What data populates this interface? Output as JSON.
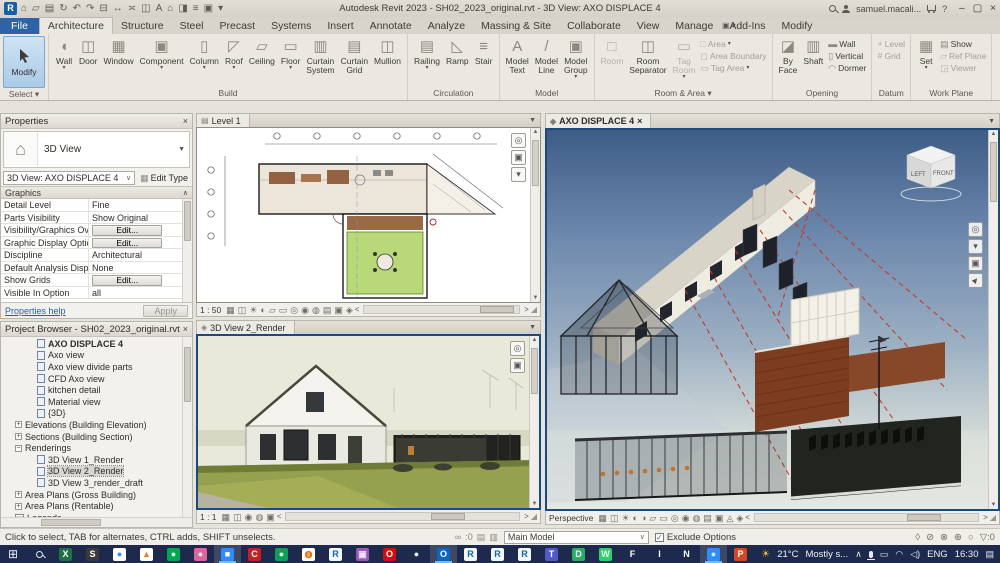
{
  "title_bar": {
    "app_title": "Autodesk Revit 2023 - SH02_2023_original.rvt - 3D View: AXO DISPLACE 4",
    "logo_letter": "R",
    "qat": [
      {
        "name": "home-icon",
        "glyph": "⌂"
      },
      {
        "name": "open-icon",
        "glyph": "▱"
      },
      {
        "name": "save-icon",
        "glyph": "▤"
      },
      {
        "name": "sync-with-central-icon",
        "glyph": "↻"
      },
      {
        "name": "undo-icon",
        "glyph": "↶"
      },
      {
        "name": "redo-icon",
        "glyph": "↷"
      },
      {
        "name": "print-icon",
        "glyph": "⊟"
      },
      {
        "name": "measure-icon",
        "glyph": "↔"
      },
      {
        "name": "aligned-dimension-icon",
        "glyph": "≍"
      },
      {
        "name": "tag-icon",
        "glyph": "◫"
      },
      {
        "name": "text-icon",
        "glyph": "A"
      },
      {
        "name": "default-3d-view-icon",
        "glyph": "⌂"
      },
      {
        "name": "section-icon",
        "glyph": "◨"
      },
      {
        "name": "thin-lines-icon",
        "glyph": "≡"
      },
      {
        "name": "switch-windows-icon",
        "glyph": "▣"
      },
      {
        "name": "customize-qat-icon",
        "glyph": "▾"
      }
    ],
    "user_name": "samuel.macali...",
    "help_label": "?",
    "window_controls": {
      "minimize": "–",
      "restore": "▢",
      "close": "×"
    }
  },
  "ribbon": {
    "tabs": [
      {
        "label": "File",
        "cls": "file"
      },
      {
        "label": "Architecture",
        "cls": "active"
      },
      {
        "label": "Structure"
      },
      {
        "label": "Steel"
      },
      {
        "label": "Precast"
      },
      {
        "label": "Systems"
      },
      {
        "label": "Insert"
      },
      {
        "label": "Annotate"
      },
      {
        "label": "Analyze"
      },
      {
        "label": "Massing & Site"
      },
      {
        "label": "Collaborate"
      },
      {
        "label": "View"
      },
      {
        "label": "Manage"
      },
      {
        "label": "Add-Ins"
      },
      {
        "label": "Modify"
      }
    ],
    "panels": {
      "select": {
        "label": "Select ▾",
        "modify_label": "Modify"
      },
      "build": {
        "label": "Build",
        "buttons": [
          {
            "name": "wall-button",
            "label": "Wall",
            "arrow": true,
            "glyph": "◖"
          },
          {
            "name": "door-button",
            "label": "Door",
            "glyph": "◫"
          },
          {
            "name": "window-button",
            "label": "Window",
            "glyph": "▦"
          },
          {
            "name": "component-button",
            "label": "Component",
            "arrow": true,
            "glyph": "▣"
          },
          {
            "name": "column-button",
            "label": "Column",
            "arrow": true,
            "glyph": "▯"
          },
          {
            "name": "roof-button",
            "label": "Roof",
            "arrow": true,
            "glyph": "◸"
          },
          {
            "name": "ceiling-button",
            "label": "Ceiling",
            "glyph": "▱"
          },
          {
            "name": "floor-button",
            "label": "Floor",
            "arrow": true,
            "glyph": "▭"
          },
          {
            "name": "curtain-system-button",
            "label": "Curtain",
            "label2": "System",
            "glyph": "▥"
          },
          {
            "name": "curtain-grid-button",
            "label": "Curtain",
            "label2": "Grid",
            "glyph": "▤"
          },
          {
            "name": "mullion-button",
            "label": "Mullion",
            "glyph": "◫"
          }
        ]
      },
      "circulation": {
        "label": "Circulation",
        "buttons": [
          {
            "name": "railing-button",
            "label": "Railing",
            "arrow": true,
            "glyph": "▤"
          },
          {
            "name": "ramp-button",
            "label": "Ramp",
            "glyph": "◺"
          },
          {
            "name": "stair-button",
            "label": "Stair",
            "glyph": "≡"
          }
        ]
      },
      "model": {
        "label": "Model",
        "buttons": [
          {
            "name": "model-text-button",
            "label": "Model",
            "label2": "Text",
            "glyph": "A"
          },
          {
            "name": "model-line-button",
            "label": "Model",
            "label2": "Line",
            "glyph": "/"
          },
          {
            "name": "model-group-button",
            "label": "Model",
            "label2": "Group",
            "arrow": true,
            "glyph": "▣"
          }
        ]
      },
      "room_area": {
        "label": "Room & Area ▾",
        "big": [
          {
            "name": "room-button",
            "label": "Room",
            "glyph": "□",
            "cls": "dis"
          },
          {
            "name": "room-separator-button",
            "label": "Room",
            "label2": "Separator",
            "glyph": "◫"
          },
          {
            "name": "tag-room-button",
            "label": "Tag",
            "label2": "Room",
            "arrow": true,
            "glyph": "▭",
            "cls": "dis"
          }
        ],
        "small": [
          {
            "name": "area-button",
            "label": "Area",
            "arrow": true,
            "glyph": "□",
            "cls": "dis"
          },
          {
            "name": "area-boundary-button",
            "label": "Area Boundary",
            "glyph": "◻",
            "cls": "dis"
          },
          {
            "name": "tag-area-button",
            "label": "Tag Area",
            "arrow": true,
            "glyph": "▭",
            "cls": "dis"
          }
        ]
      },
      "opening": {
        "label": "Opening",
        "big": [
          {
            "name": "opening-by-face-button",
            "label": "By",
            "label2": "Face",
            "glyph": "◪"
          },
          {
            "name": "shaft-button",
            "label": "Shaft",
            "glyph": "▥"
          }
        ],
        "small": [
          {
            "name": "wall-opening-button",
            "label": "Wall",
            "glyph": "▬"
          },
          {
            "name": "vertical-opening-button",
            "label": "Vertical",
            "glyph": "▯"
          },
          {
            "name": "dormer-button",
            "label": "Dormer",
            "glyph": "◠"
          }
        ]
      },
      "datum": {
        "label": "Datum",
        "small": [
          {
            "name": "level-button",
            "label": "Level",
            "glyph": "+",
            "cls": "dis"
          },
          {
            "name": "grid-button",
            "label": "Grid",
            "glyph": "#",
            "cls": "dis"
          }
        ]
      },
      "work_plane": {
        "label": "Work Plane",
        "big": [
          {
            "name": "set-work-plane-button",
            "label": "Set",
            "arrow": true,
            "glyph": "▦"
          }
        ],
        "small": [
          {
            "name": "show-work-plane-button",
            "label": "Show",
            "glyph": "▤"
          },
          {
            "name": "ref-plane-button",
            "label": "Ref Plane",
            "glyph": "▱",
            "cls": "dis"
          },
          {
            "name": "viewer-button",
            "label": "Viewer",
            "glyph": "◲",
            "cls": "dis"
          }
        ]
      }
    }
  },
  "properties": {
    "title": "Properties",
    "type_label": "3D View",
    "selector_value": "3D View: AXO DISPLACE 4",
    "edit_type_label": "Edit Type",
    "section": "Graphics",
    "rows": [
      {
        "label": "Detail Level",
        "value": "Fine",
        "text": true
      },
      {
        "label": "Parts Visibility",
        "value": "Show Original",
        "text": true
      },
      {
        "label": "Visibility/Graphics Ov...",
        "value": "Edit...",
        "btn": true
      },
      {
        "label": "Graphic Display Optio...",
        "value": "Edit...",
        "btn": true
      },
      {
        "label": "Discipline",
        "value": "Architectural",
        "text": true
      },
      {
        "label": "Default Analysis Displ...",
        "value": "None",
        "text": true
      },
      {
        "label": "Show Grids",
        "value": "Edit...",
        "btn": true
      },
      {
        "label": "Visible In Option",
        "value": "all",
        "text": true
      }
    ],
    "help_link": "Properties help",
    "apply_label": "Apply"
  },
  "project_browser": {
    "title": "Project Browser - SH02_2023_original.rvt",
    "items": [
      {
        "label": "AXO DISPLACE 4",
        "cls": "lvl2 bold",
        "vicon": true
      },
      {
        "label": "Axo view",
        "cls": "lvl2",
        "vicon": true
      },
      {
        "label": "Axo view divide parts",
        "cls": "lvl2",
        "vicon": true
      },
      {
        "label": "CFD Axo view",
        "cls": "lvl2",
        "vicon": true
      },
      {
        "label": "kitchen detail",
        "cls": "lvl2",
        "vicon": true
      },
      {
        "label": "Material view",
        "cls": "lvl2",
        "vicon": true
      },
      {
        "label": "{3D}",
        "cls": "lvl2",
        "vicon": true
      },
      {
        "label": "Elevations (Building Elevation)",
        "cls": "lvl1",
        "exp": "+"
      },
      {
        "label": "Sections (Building Section)",
        "cls": "lvl1",
        "exp": "+"
      },
      {
        "label": "Renderings",
        "cls": "lvl1",
        "exp": "−"
      },
      {
        "label": "3D View 1_Render",
        "cls": "lvl2",
        "vicon": true
      },
      {
        "label": "3D View 2_Render",
        "cls": "lvl2 sel",
        "vicon": true
      },
      {
        "label": "3D View 3_render_draft",
        "cls": "lvl2",
        "vicon": true
      },
      {
        "label": "Area Plans (Gross Building)",
        "cls": "lvl1",
        "exp": "+"
      },
      {
        "label": "Area Plans (Rentable)",
        "cls": "lvl1",
        "exp": "+"
      },
      {
        "label": "Legends",
        "cls": "lvl1",
        "licon": true
      }
    ]
  },
  "viewports": {
    "plan": {
      "tab": "Level 1",
      "scale": "1 : 50",
      "icons": [
        {
          "name": "detail-level-icon",
          "glyph": "▦"
        },
        {
          "name": "visual-style-icon",
          "glyph": "◫"
        },
        {
          "name": "sun-path-icon",
          "glyph": "☀"
        },
        {
          "name": "shadows-icon",
          "glyph": "◐"
        },
        {
          "name": "crop-view-icon",
          "glyph": "▱"
        },
        {
          "name": "show-crop-region-icon",
          "glyph": "▭"
        },
        {
          "name": "unlocked-view-icon",
          "glyph": "◎"
        },
        {
          "name": "temporary-hide-isolate-icon",
          "glyph": "◉"
        },
        {
          "name": "reveal-hidden-elements-icon",
          "glyph": "◍"
        },
        {
          "name": "worksharing-display-icon",
          "glyph": "▤"
        },
        {
          "name": "temporary-view-properties-icon",
          "glyph": "▣"
        },
        {
          "name": "reveal-constraints-icon",
          "glyph": "◈"
        }
      ]
    },
    "render": {
      "tab": "3D View 2_Render",
      "scale": "1 : 1",
      "icons": [
        {
          "name": "detail-level-icon",
          "glyph": "▦"
        },
        {
          "name": "visual-style-icon",
          "glyph": "◫"
        },
        {
          "name": "temporary-hide-isolate-icon",
          "glyph": "◉"
        },
        {
          "name": "reveal-hidden-elements-icon",
          "glyph": "◍"
        },
        {
          "name": "temporary-view-properties-icon",
          "glyph": "▣"
        }
      ]
    },
    "axo": {
      "tab": "AXO DISPLACE 4",
      "close": "×",
      "mode": "Perspective",
      "viewcube": {
        "left": "LEFT",
        "front": "FRONT"
      },
      "icons": [
        {
          "name": "detail-level-icon",
          "glyph": "▦"
        },
        {
          "name": "visual-style-icon",
          "glyph": "◫"
        },
        {
          "name": "sun-path-icon",
          "glyph": "☀"
        },
        {
          "name": "shadows-icon",
          "glyph": "◐"
        },
        {
          "name": "sketchy-lines-icon",
          "glyph": "◑"
        },
        {
          "name": "crop-view-icon",
          "glyph": "▱"
        },
        {
          "name": "show-crop-region-icon",
          "glyph": "▭"
        },
        {
          "name": "unlocked-view-icon",
          "glyph": "◎"
        },
        {
          "name": "temporary-hide-isolate-icon",
          "glyph": "◉"
        },
        {
          "name": "reveal-hidden-elements-icon",
          "glyph": "◍"
        },
        {
          "name": "worksharing-display-icon",
          "glyph": "▤"
        },
        {
          "name": "temporary-view-properties-icon",
          "glyph": "▣"
        },
        {
          "name": "analytical-model-icon",
          "glyph": "◬"
        },
        {
          "name": "reveal-constraints-icon",
          "glyph": "◈"
        }
      ]
    }
  },
  "status_bar": {
    "hint": "Click to select, TAB for alternates, CTRL adds, SHIFT unselects.",
    "editing_requests_count": ":0",
    "main_model": "Main Model",
    "exclude_options": "Exclude Options",
    "left_icons": [
      {
        "name": "editing-requests-icon",
        "glyph": "∞"
      },
      {
        "name": "worksets-icon",
        "glyph": "▤"
      },
      {
        "name": "design-options-icon",
        "glyph": "▥"
      }
    ],
    "right_icons": [
      {
        "name": "select-links-icon",
        "glyph": "◊"
      },
      {
        "name": "select-underlay-elements-icon",
        "glyph": "⊘"
      },
      {
        "name": "select-pinned-elements-icon",
        "glyph": "⊗"
      },
      {
        "name": "select-elements-by-face-icon",
        "glyph": "⊕"
      },
      {
        "name": "drag-elements-on-selection-icon",
        "glyph": "○"
      }
    ],
    "filter_glyph": "▽",
    "filter_count": ":0"
  },
  "taskbar": {
    "apps": [
      {
        "name": "excel-icon",
        "letter": "X",
        "bg": "#1e7145",
        "fg": "#ffffff"
      },
      {
        "name": "snip-sketch-icon",
        "letter": "S",
        "bg": "#3a3a3a",
        "fg": "#ffffff"
      },
      {
        "name": "chrome-icon",
        "letter": "●",
        "bg": "#ffffff",
        "fg": "#4285f4"
      },
      {
        "name": "vlc-icon",
        "letter": "▲",
        "bg": "#ffffff",
        "fg": "#f4811f"
      },
      {
        "name": "camtasia-icon",
        "letter": "●",
        "bg": "#00a651",
        "fg": "#d6f5e2"
      },
      {
        "name": "pink-app-icon",
        "letter": "●",
        "bg": "#d6679f",
        "fg": "#ffe3f0"
      },
      {
        "name": "zoom-icon",
        "letter": "■",
        "bg": "#2d8cff",
        "fg": "#ffffff",
        "cls": "on"
      },
      {
        "name": "adobe-cc-icon",
        "letter": "C",
        "bg": "#c42127",
        "fg": "#ffffff"
      },
      {
        "name": "phone-app-icon",
        "letter": "●",
        "bg": "#0f9d58",
        "fg": "#e0ffe8"
      },
      {
        "name": "browser-sphere-icon",
        "letter": "◍",
        "bg": "#ffffff",
        "fg": "#e66000"
      },
      {
        "name": "revit-icon",
        "letter": "R",
        "bg": "#f4f6f8",
        "fg": "#0a66b0"
      },
      {
        "name": "photos-icon",
        "letter": "▣",
        "bg": "#9b59b6",
        "fg": "#f2e5ff"
      },
      {
        "name": "opera-icon",
        "letter": "O",
        "bg": "#cc0f16",
        "fg": "#ffffff"
      },
      {
        "name": "white-circle-app-icon",
        "letter": "●",
        "bg": "#1d2a4d",
        "fg": "#eeeeee"
      },
      {
        "name": "outlook-icon",
        "letter": "O",
        "bg": "#0a66c2",
        "fg": "#ffffff",
        "cls": "on"
      },
      {
        "name": "revit-instance-icon",
        "letter": "R",
        "bg": "#f4f6f8",
        "fg": "#0a66b0"
      },
      {
        "name": "revit-instance-icon",
        "letter": "R",
        "bg": "#f4f6f8",
        "fg": "#0a66b0"
      },
      {
        "name": "revit-instance-icon",
        "letter": "R",
        "bg": "#f4f6f8",
        "fg": "#0a66b0"
      },
      {
        "name": "teams-icon",
        "letter": "T",
        "bg": "#5059c9",
        "fg": "#ffffff"
      },
      {
        "name": "docs-app-icon",
        "letter": "D",
        "bg": "#27ae60",
        "fg": "#ffffff"
      },
      {
        "name": "whatsapp-icon",
        "letter": "W",
        "bg": "#25d366",
        "fg": "#ffffff"
      },
      {
        "name": "app-f-icon",
        "letter": "F",
        "bg": "#1d2a4d",
        "fg": "#ffffff"
      },
      {
        "name": "app-i-icon",
        "letter": "I",
        "bg": "#1d2a4d",
        "fg": "#ffffff"
      },
      {
        "name": "notion-icon",
        "letter": "N",
        "bg": "#1d2a4d",
        "fg": "#ffffff"
      },
      {
        "name": "people-app-icon",
        "letter": "●",
        "bg": "#2d8cff",
        "fg": "#dce9ff",
        "cls": "on"
      },
      {
        "name": "powerpoint-icon",
        "letter": "P",
        "bg": "#d24726",
        "fg": "#ffffff"
      }
    ],
    "tray": {
      "weather_temp": "21°C",
      "weather_desc": "Mostly s...",
      "language": "ENG",
      "time": "16:30"
    }
  }
}
